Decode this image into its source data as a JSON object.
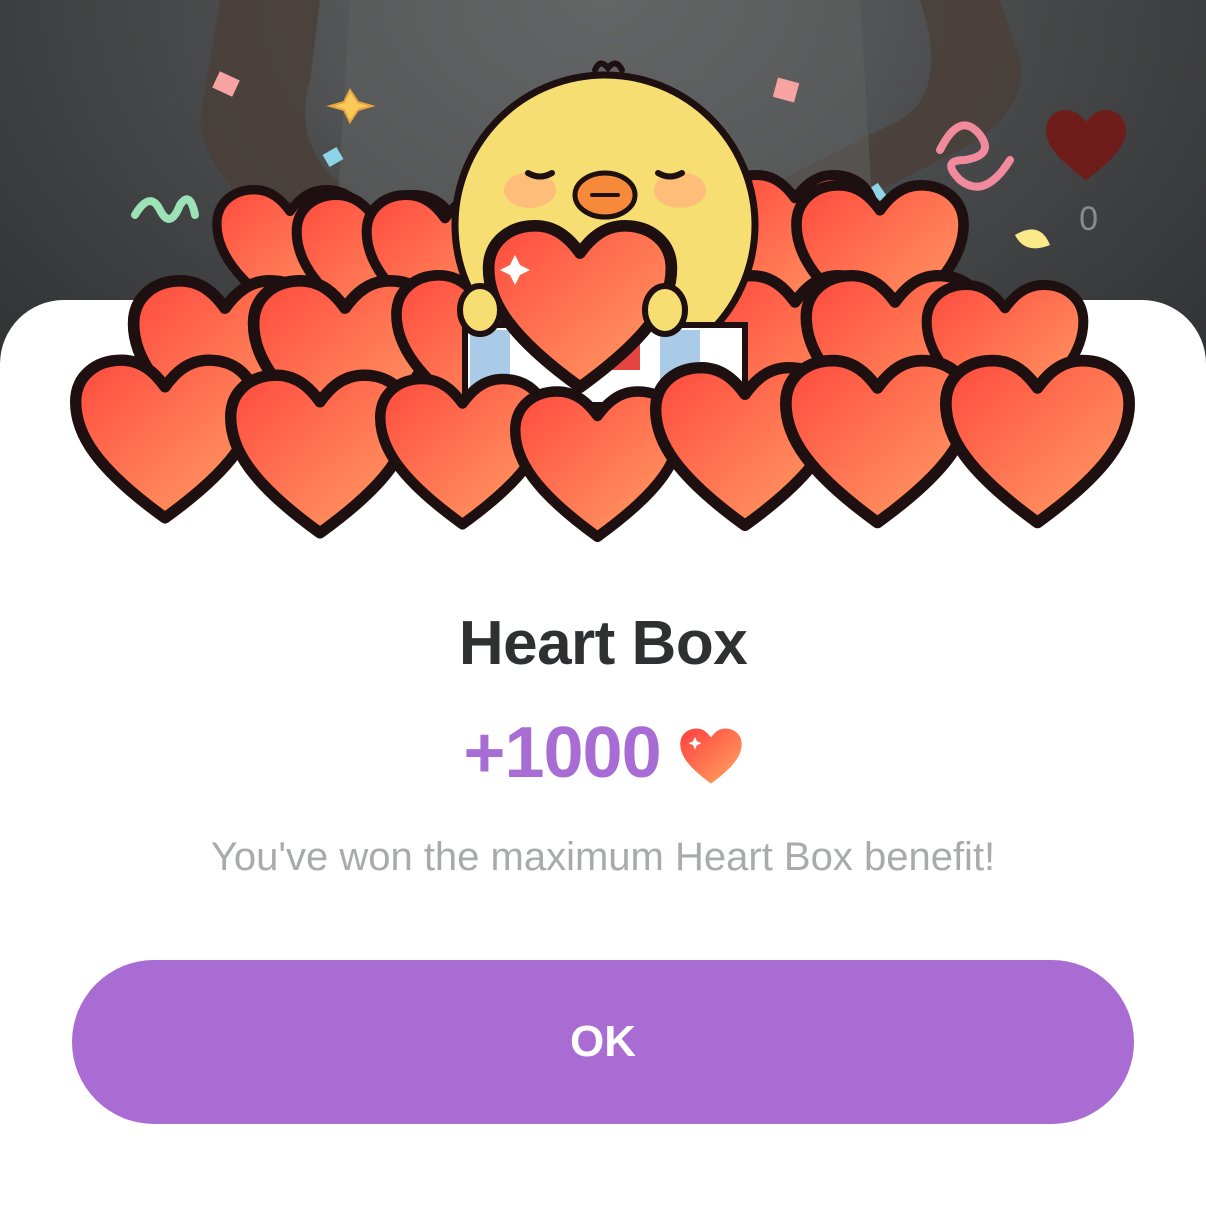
{
  "background": {
    "like_count": "0"
  },
  "dialog": {
    "title": "Heart Box",
    "amount": "+1000",
    "message": "You've won the maximum Heart Box benefit!",
    "ok_label": "OK",
    "icons": [
      "chick-with-hearts-illustration",
      "heart-icon"
    ]
  },
  "colors": {
    "accent_purple": "#a86cd3",
    "amount_purple": "#a76dd4",
    "heart_red": "#ff5a4a",
    "heart_orange": "#ff9a62",
    "title_text": "#2f3032",
    "secondary_text": "#a9aaab"
  }
}
